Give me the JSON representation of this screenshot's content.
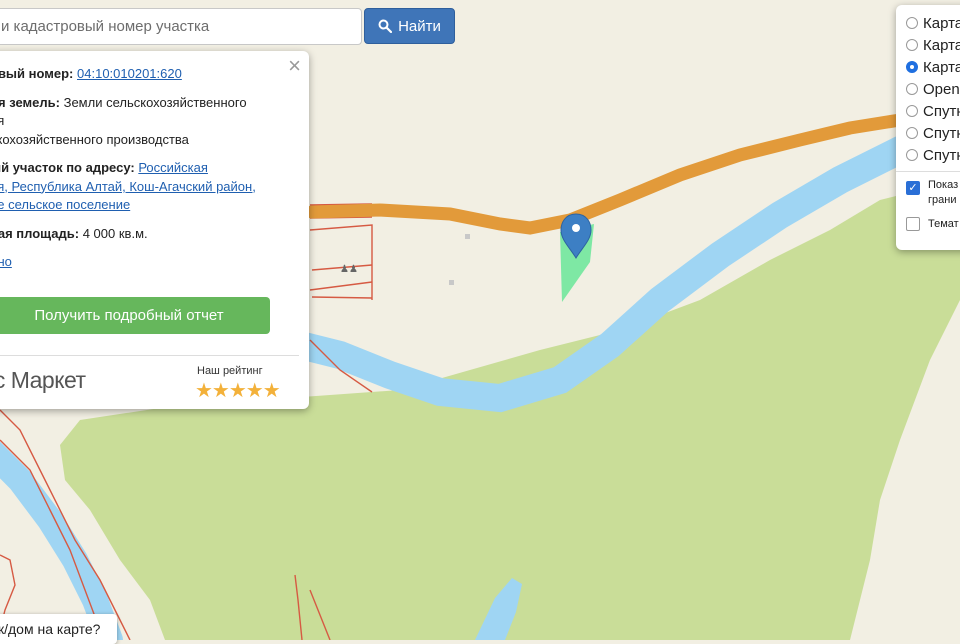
{
  "search": {
    "placeholder": "и кадастровый номер участка",
    "button_label": "Найти"
  },
  "popup": {
    "cadastral_label": "овый номер:",
    "cadastral_value": "04:10:010201:620",
    "category_label": "ия земель:",
    "category_value": "Земли сельскохозяйственного",
    "category_line2": "ия",
    "category_line3": "скохозяйственного производства",
    "address_label": "ый участок по адресу:",
    "address_link1": "Российская",
    "address_link2": "ия, Республика Алтай, Кош-Агачский район,",
    "address_link3": "ое сельское поселение",
    "area_label": "ная площадь:",
    "area_value": "4 000 кв.м.",
    "more_link": "бно",
    "report_button": "Получить подробный отчет",
    "market_logo": "кс Маркет",
    "rating_label": "Наш рейтинг",
    "stars": "★★★★★",
    "close": "×"
  },
  "layers": {
    "options": [
      {
        "label": "Карта",
        "selected": false
      },
      {
        "label": "Карта",
        "selected": false
      },
      {
        "label": "Карта",
        "selected": true
      },
      {
        "label": "Open",
        "selected": false
      },
      {
        "label": "Спутн",
        "selected": false
      },
      {
        "label": "Спутн",
        "selected": false
      },
      {
        "label": "Спутн",
        "selected": false
      }
    ],
    "show_label_1": "Показ",
    "show_label_2": "грани",
    "thematic_label": "Темат"
  },
  "bottom_question": "к/дом на карте?",
  "colors": {
    "land": "#f2efe3",
    "green_area": "#c9dd98",
    "river": "#9fd5f3",
    "road": "#e29a3a",
    "parcel": "#7ee8a4",
    "boundary": "#d65a43",
    "marker": "#3d7fc4",
    "search_button": "#3f75b8",
    "report_button": "#66b75c"
  }
}
